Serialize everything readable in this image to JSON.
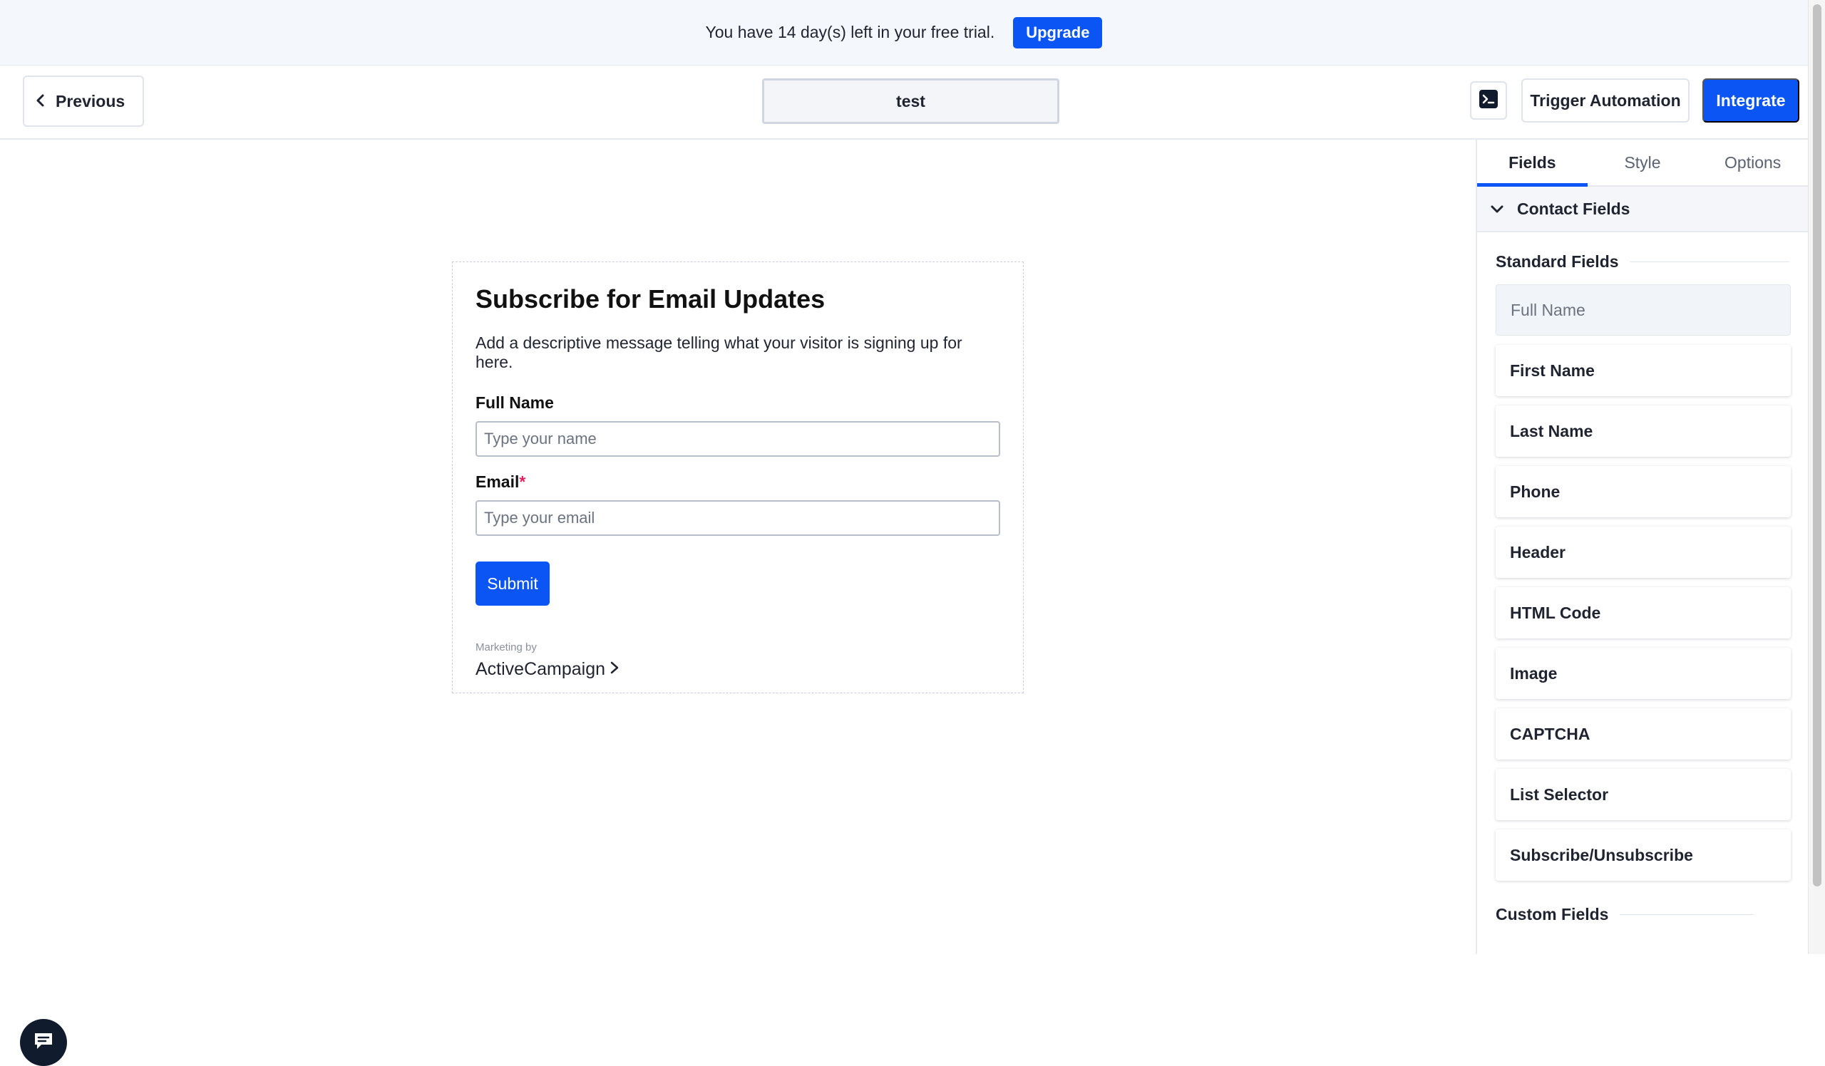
{
  "banner": {
    "text": "You have 14 day(s) left in your free trial.",
    "upgrade_label": "Upgrade"
  },
  "toolbar": {
    "previous_label": "Previous",
    "form_name": "test",
    "console_icon": "terminal-icon",
    "trigger_label": "Trigger Automation",
    "integrate_label": "Integrate"
  },
  "form": {
    "title": "Subscribe for Email Updates",
    "description": "Add a descriptive message telling what your visitor is signing up for here.",
    "fields": [
      {
        "label": "Full Name",
        "required": false,
        "placeholder": "Type your name"
      },
      {
        "label": "Email",
        "required": true,
        "required_mark": "*",
        "placeholder": "Type your email"
      }
    ],
    "submit_label": "Submit",
    "powered_by_small": "Marketing by",
    "powered_by_brand": "ActiveCampaign"
  },
  "panel": {
    "tabs": [
      {
        "label": "Fields",
        "active": true
      },
      {
        "label": "Style",
        "active": false
      },
      {
        "label": "Options",
        "active": false
      }
    ],
    "section_title": "Contact Fields",
    "standard_fields_title": "Standard Fields",
    "standard_fields": [
      {
        "label": "Full Name",
        "disabled": true
      },
      {
        "label": "First Name",
        "disabled": false
      },
      {
        "label": "Last Name",
        "disabled": false
      },
      {
        "label": "Phone",
        "disabled": false
      },
      {
        "label": "Header",
        "disabled": false
      },
      {
        "label": "HTML Code",
        "disabled": false
      },
      {
        "label": "Image",
        "disabled": false
      },
      {
        "label": "CAPTCHA",
        "disabled": false
      },
      {
        "label": "List Selector",
        "disabled": false
      },
      {
        "label": "Subscribe/Unsubscribe",
        "disabled": false
      }
    ],
    "custom_fields_title": "Custom Fields"
  },
  "colors": {
    "accent": "#0c55f5",
    "banner_bg": "#f4f7fc",
    "required": "#e0245e",
    "chat_bubble": "#111b2e"
  }
}
